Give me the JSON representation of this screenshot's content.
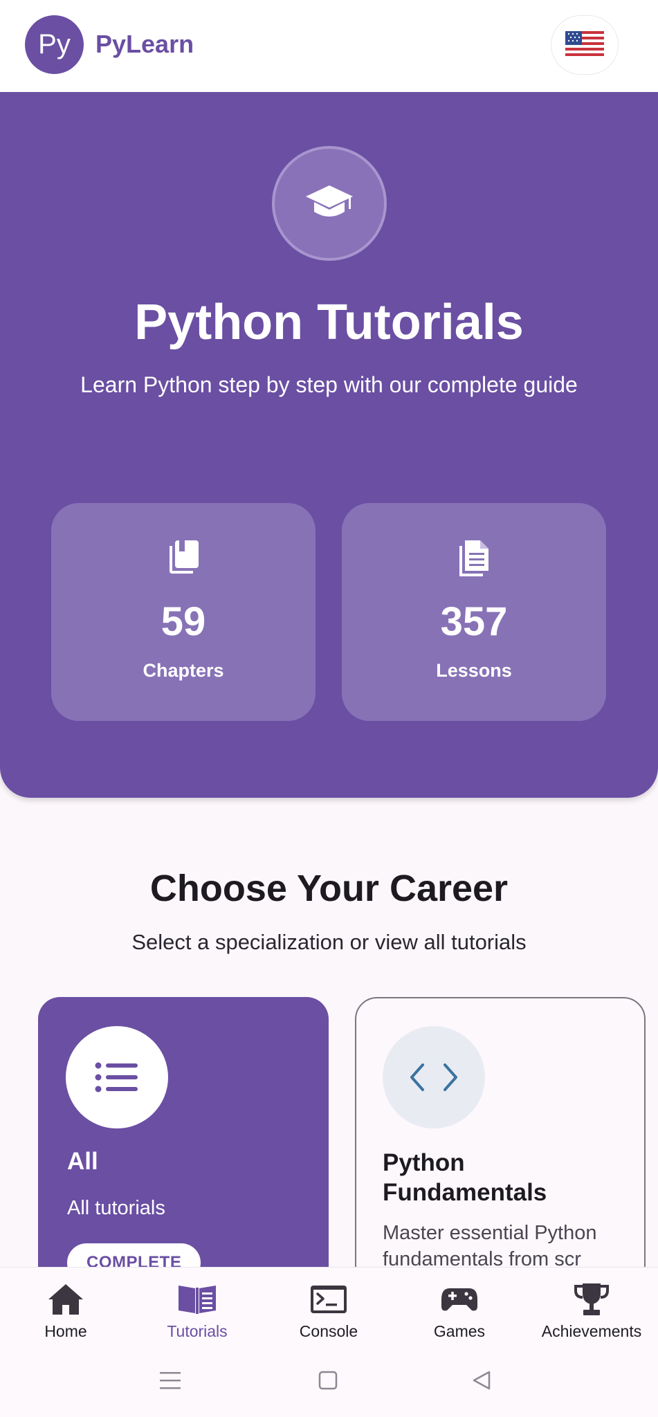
{
  "header": {
    "logo_text": "Py",
    "app_name": "PyLearn",
    "language_flag": "us-flag-icon"
  },
  "hero": {
    "icon": "graduation-cap-icon",
    "title": "Python Tutorials",
    "subtitle": "Learn Python step by step with our complete guide",
    "stats": [
      {
        "icon": "book-icon",
        "value": "59",
        "label": "Chapters"
      },
      {
        "icon": "document-icon",
        "value": "357",
        "label": "Lessons"
      }
    ]
  },
  "career": {
    "title": "Choose Your Career",
    "subtitle": "Select a specialization or view all tutorials",
    "cards": [
      {
        "icon": "list-icon",
        "title": "All",
        "description": "All tutorials",
        "badge": "COMPLETE"
      },
      {
        "icon": "code-icon",
        "title": "Python Fundamentals",
        "description": "Master essential Python fundamentals from scr"
      }
    ]
  },
  "bottom_nav": [
    {
      "icon": "home-icon",
      "label": "Home",
      "active": false
    },
    {
      "icon": "book-open-icon",
      "label": "Tutorials",
      "active": true
    },
    {
      "icon": "terminal-icon",
      "label": "Console",
      "active": false
    },
    {
      "icon": "gamepad-icon",
      "label": "Games",
      "active": false
    },
    {
      "icon": "trophy-icon",
      "label": "Achievements",
      "active": false
    }
  ],
  "colors": {
    "primary": "#6a4fa3",
    "stat_card": "#8772b6",
    "background": "#fcf7fb"
  }
}
